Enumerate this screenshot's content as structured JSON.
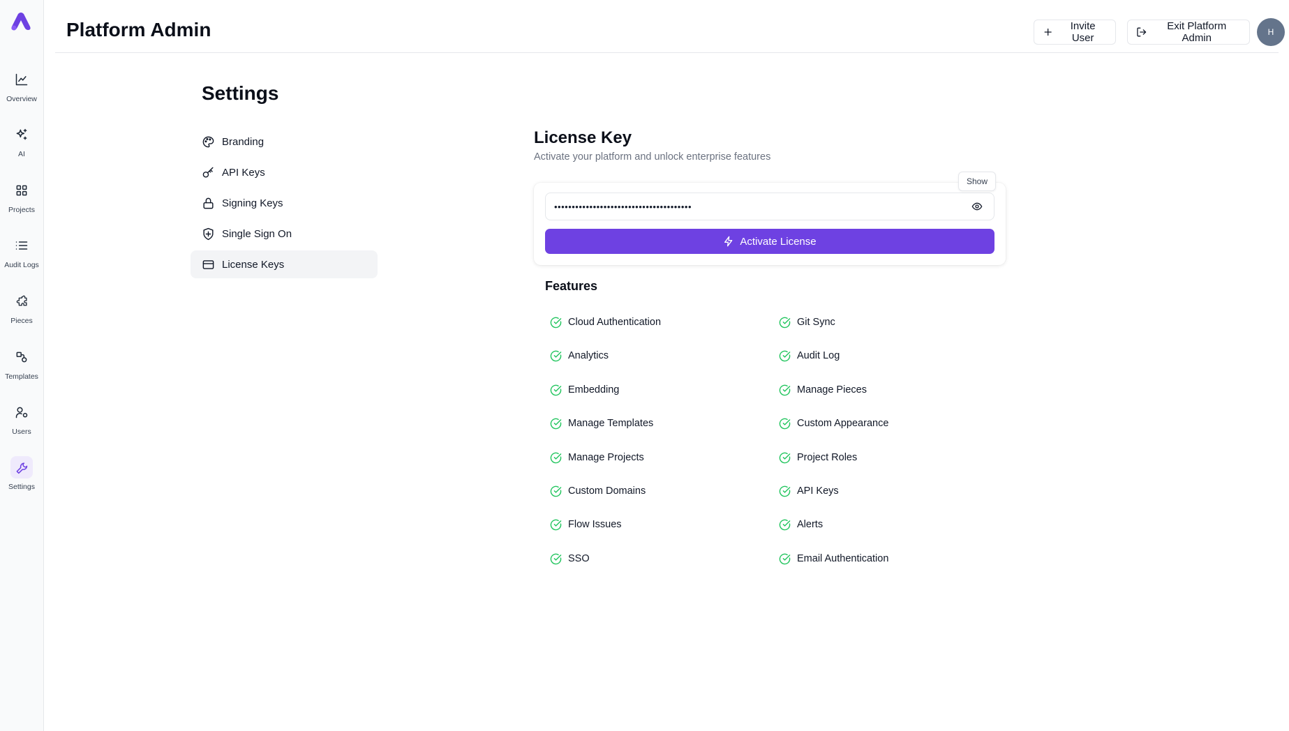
{
  "header": {
    "title": "Platform Admin",
    "invite_label": "Invite User",
    "exit_label": "Exit Platform Admin",
    "avatar_initial": "H"
  },
  "rail": {
    "items": [
      {
        "label": "Overview",
        "icon": "chart-line-icon"
      },
      {
        "label": "AI",
        "icon": "sparkles-icon"
      },
      {
        "label": "Projects",
        "icon": "grid-icon"
      },
      {
        "label": "Audit Logs",
        "icon": "list-icon"
      },
      {
        "label": "Pieces",
        "icon": "puzzle-icon"
      },
      {
        "label": "Templates",
        "icon": "shapes-icon"
      },
      {
        "label": "Users",
        "icon": "user-cog-icon"
      },
      {
        "label": "Settings",
        "icon": "wrench-icon"
      }
    ],
    "active": "Settings"
  },
  "settings": {
    "title": "Settings",
    "nav": [
      {
        "label": "Branding",
        "icon": "palette-icon"
      },
      {
        "label": "API Keys",
        "icon": "key-icon"
      },
      {
        "label": "Signing Keys",
        "icon": "lock-icon"
      },
      {
        "label": "Single Sign On",
        "icon": "shield-icon"
      },
      {
        "label": "License Keys",
        "icon": "card-icon"
      }
    ],
    "active": "License Keys"
  },
  "license": {
    "title": "License Key",
    "subtitle": "Activate your platform and unlock enterprise features",
    "key_value": "•••••••••••••••••••••••••••••••••••••••",
    "show_tooltip": "Show",
    "activate_label": "Activate License"
  },
  "features": {
    "title": "Features",
    "left": [
      "Cloud Authentication",
      "Analytics",
      "Embedding",
      "Manage Templates",
      "Manage Projects",
      "Custom Domains",
      "Flow Issues",
      "SSO"
    ],
    "right": [
      "Git Sync",
      "Audit Log",
      "Manage Pieces",
      "Custom Appearance",
      "Project Roles",
      "API Keys",
      "Alerts",
      "Email Authentication"
    ]
  },
  "colors": {
    "accent": "#6e41e2",
    "check": "#22c55e"
  }
}
